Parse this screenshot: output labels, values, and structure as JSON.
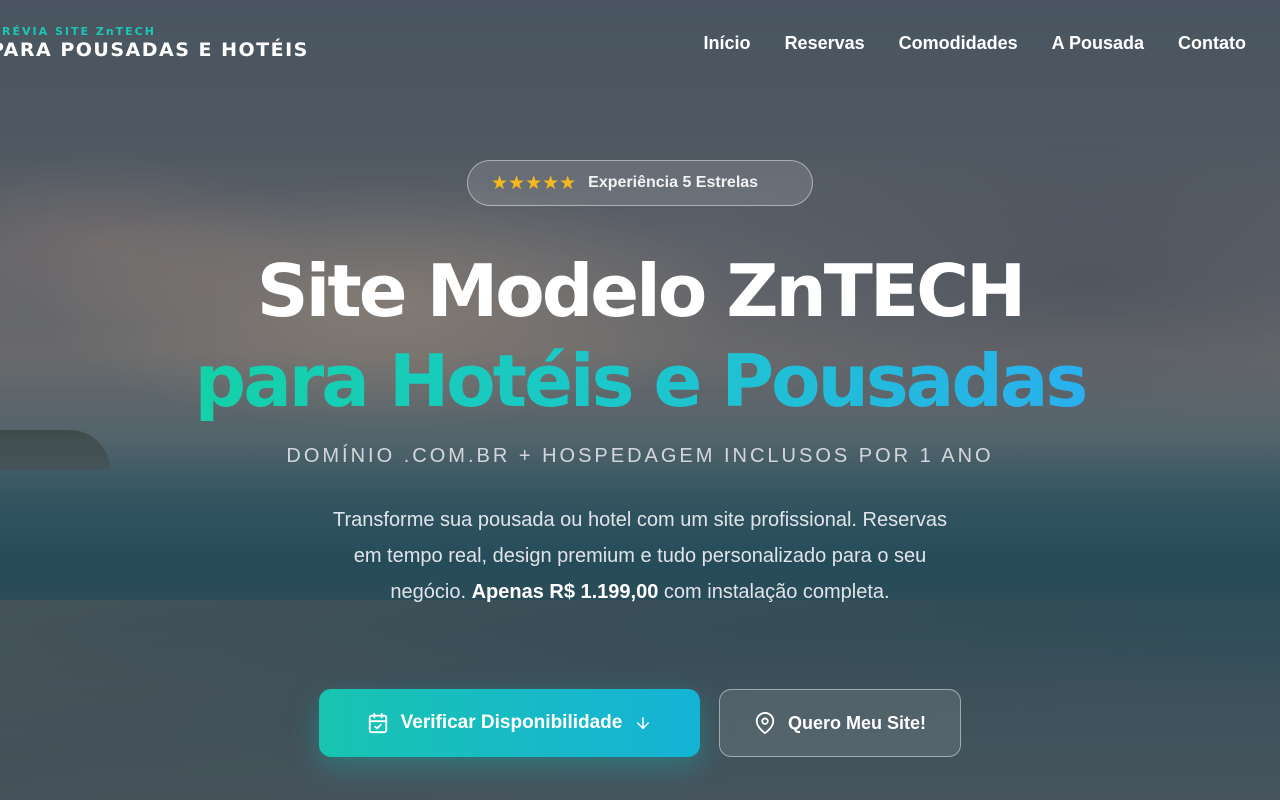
{
  "brand": {
    "tagline": "PRÉVIA SITE ZnTECH",
    "name": "PARA POUSADAS E HOTÉIS"
  },
  "nav": {
    "items": [
      {
        "label": "Início"
      },
      {
        "label": "Reservas"
      },
      {
        "label": "Comodidades"
      },
      {
        "label": "A Pousada"
      },
      {
        "label": "Contato"
      }
    ]
  },
  "hero": {
    "badge": {
      "rating": 5,
      "stars": "★★★★★",
      "text": "Experiência 5 Estrelas"
    },
    "title_line1": "Site Modelo ZnTECH",
    "title_line2": "para Hotéis e Pousadas",
    "subtitle": "DOMÍNIO .COM.BR + HOSPEDAGEM INCLUSOS POR 1 ANO",
    "description": {
      "part1": "Transforme sua pousada ou hotel com um site profissional. Reservas em tempo real, design premium e tudo personalizado para o seu negócio. ",
      "price": "Apenas R$ 1.199,00",
      "part2": " com instalação completa."
    },
    "primary_button": {
      "label": "Verificar Disponibilidade",
      "icon": "calendar-check-icon",
      "trailing_icon": "arrow-down-icon"
    },
    "secondary_button": {
      "label": "Quero Meu Site!",
      "icon": "map-pin-icon"
    }
  },
  "colors": {
    "accent_teal": "#19c7b6",
    "accent_blue": "#2ab0ee",
    "star_gold": "#f6b81f"
  }
}
